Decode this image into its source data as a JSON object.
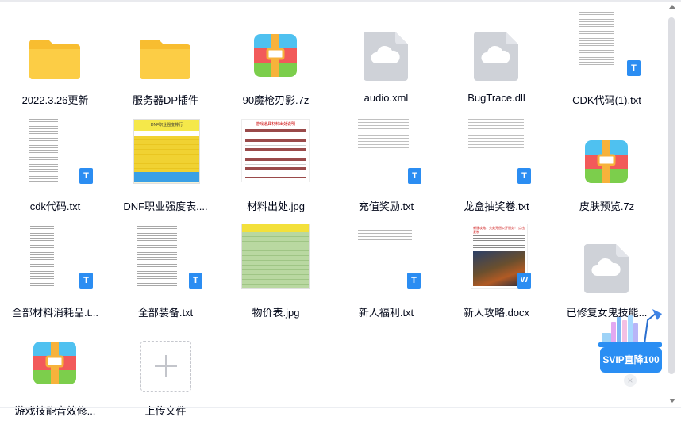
{
  "files": [
    {
      "name": "2022.3.26更新",
      "type": "folder"
    },
    {
      "name": "服务器DP插件",
      "type": "folder"
    },
    {
      "name": "90魔枪刃影.7z",
      "type": "archive"
    },
    {
      "name": "audio.xml",
      "type": "generic"
    },
    {
      "name": "BugTrace.dll",
      "type": "generic"
    },
    {
      "name": "CDK代码(1).txt",
      "type": "text-thumb"
    },
    {
      "name": "cdk代码.txt",
      "type": "text-thumb"
    },
    {
      "name": "DNF职业强度表....",
      "type": "sheet-thumb"
    },
    {
      "name": "材料出处.jpg",
      "type": "image-list-thumb"
    },
    {
      "name": "充值奖励.txt",
      "type": "text-thumb-sparse"
    },
    {
      "name": "龙盒抽奖卷.txt",
      "type": "text-thumb-sparse"
    },
    {
      "name": "皮肤预览.7z",
      "type": "archive"
    },
    {
      "name": "全部材料消耗品.t...",
      "type": "text-thumb"
    },
    {
      "name": "全部装备.txt",
      "type": "text-thumb"
    },
    {
      "name": "物价表.jpg",
      "type": "green-sheet-thumb"
    },
    {
      "name": "新人福利.txt",
      "type": "text-thumb-sparse"
    },
    {
      "name": "新人攻略.docx",
      "type": "doc-thumb"
    },
    {
      "name": "已修复女鬼技能...",
      "type": "generic"
    },
    {
      "name": "游戏技能音效修...",
      "type": "archive"
    },
    {
      "name": "上传文件",
      "type": "upload"
    }
  ],
  "thumbnails": {
    "sheet_title": "DNF职业强度排行",
    "image_list_title": "游戏道具材料出处说明",
    "doc_title": "新服攻略：完美无偿公开服务！ 点击复制"
  },
  "badges": {
    "txt": "T",
    "docx": "W"
  },
  "promo": {
    "label": "SVIP直降100",
    "close": "×"
  },
  "colors": {
    "folder": "#fccd45",
    "generic_icon": "#cfd2d8",
    "badge": "#2b8df2"
  }
}
